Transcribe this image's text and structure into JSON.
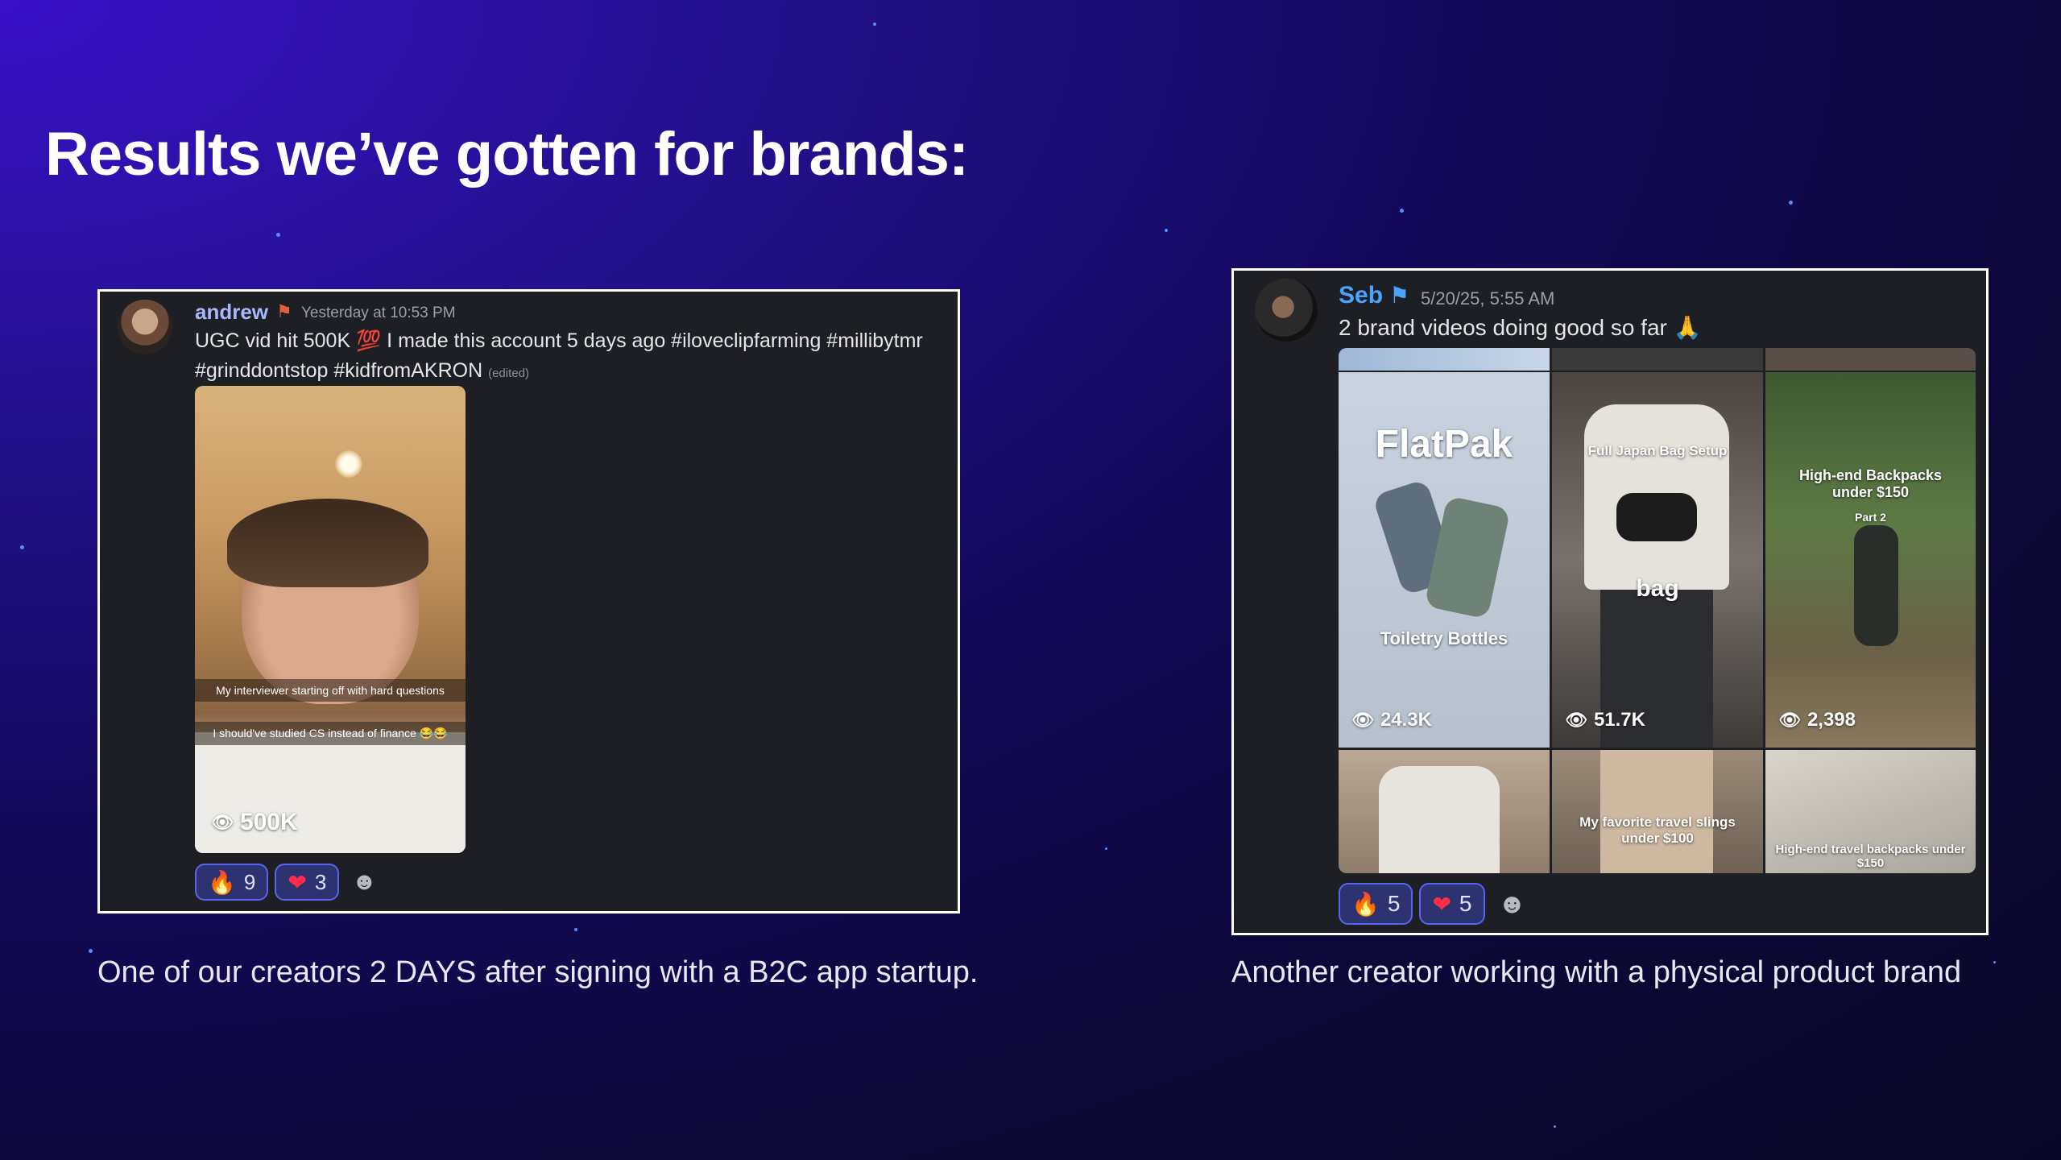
{
  "heading": "Results we’ve gotten for brands:",
  "colors": {
    "accent": "#5865f2",
    "username_andrew": "#a8b8ff",
    "username_seb": "#4aa3ff"
  },
  "left_card": {
    "username": "andrew",
    "role_icon": "role-flag-icon",
    "timestamp": "Yesterday at 10:53 PM",
    "message_part1": "UGC vid hit 500K",
    "message_emoji": "💯",
    "message_part2": " I made this account 5 days ago #iloveclipfarming #millibytmr",
    "message_line2": "#grinddontstop #kidfromAKRON",
    "edited_label": "(edited)",
    "video": {
      "caption1": "My interviewer starting off with hard questions",
      "caption2": "I should've studied CS instead of finance 😂😂",
      "views": "500K"
    },
    "reactions": [
      {
        "icon": "fire-emoji-icon",
        "glyph": "🔥",
        "count": "9"
      },
      {
        "icon": "heart-emoji-icon",
        "glyph": "❤",
        "count": "3"
      }
    ],
    "add_reaction_icon": "smiley-icon"
  },
  "left_caption": "One of our creators 2 DAYS after signing with a B2C app startup.",
  "right_card": {
    "username": "Seb",
    "role_icon": "role-flag-icon",
    "timestamp": "5/20/25, 5:55 AM",
    "message": "2 brand videos doing good so far",
    "message_emoji": "🙏",
    "tiles": [
      {
        "title": "FlatPak",
        "subtitle": "Toiletry Bottles",
        "views": "24.3K"
      },
      {
        "title": "Full Japan Bag Setup",
        "subtitle": "bag",
        "views": "51.7K"
      },
      {
        "title": "High-end Backpacks under $150",
        "subtitle": "Part 2",
        "views": "2,398"
      },
      {
        "title": "",
        "subtitle": ""
      },
      {
        "title": "My favorite travel slings under $100",
        "subtitle": ""
      },
      {
        "title": "High-end travel backpacks under $150",
        "subtitle": ""
      }
    ],
    "reactions": [
      {
        "icon": "fire-emoji-icon",
        "glyph": "🔥",
        "count": "5"
      },
      {
        "icon": "heart-emoji-icon",
        "glyph": "❤",
        "count": "5"
      }
    ],
    "add_reaction_icon": "smiley-icon"
  },
  "right_caption": "Another creator working with a physical product brand"
}
